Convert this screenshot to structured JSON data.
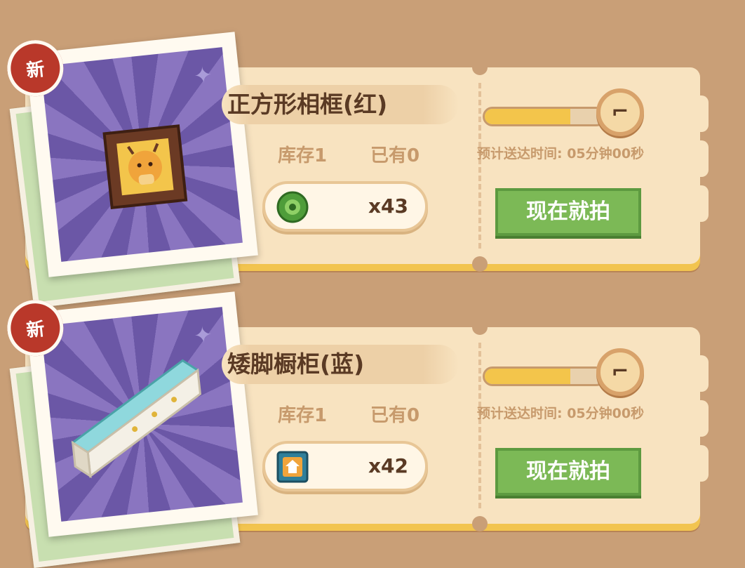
{
  "items": [
    {
      "badge": "新",
      "name": "正方形相框(红)",
      "stock": "库存1",
      "owned": "已有0",
      "cost_icon": "donut-token-icon",
      "cost_qty": "x43",
      "progress": 0.72,
      "eta": "预计送达时间: 05分钟00秒",
      "button": "现在就拍",
      "colors": {
        "accent": "#7cb956",
        "badge": "#b9382a",
        "progress": "#f3c54b"
      }
    },
    {
      "badge": "新",
      "name": "矮脚橱柜(蓝)",
      "stock": "库存1",
      "owned": "已有0",
      "cost_icon": "house-ticket-icon",
      "cost_qty": "x42",
      "progress": 0.72,
      "eta": "预计送达时间: 05分钟00秒",
      "button": "现在就拍",
      "colors": {
        "accent": "#7cb956",
        "badge": "#b9382a",
        "progress": "#f3c54b"
      }
    }
  ]
}
